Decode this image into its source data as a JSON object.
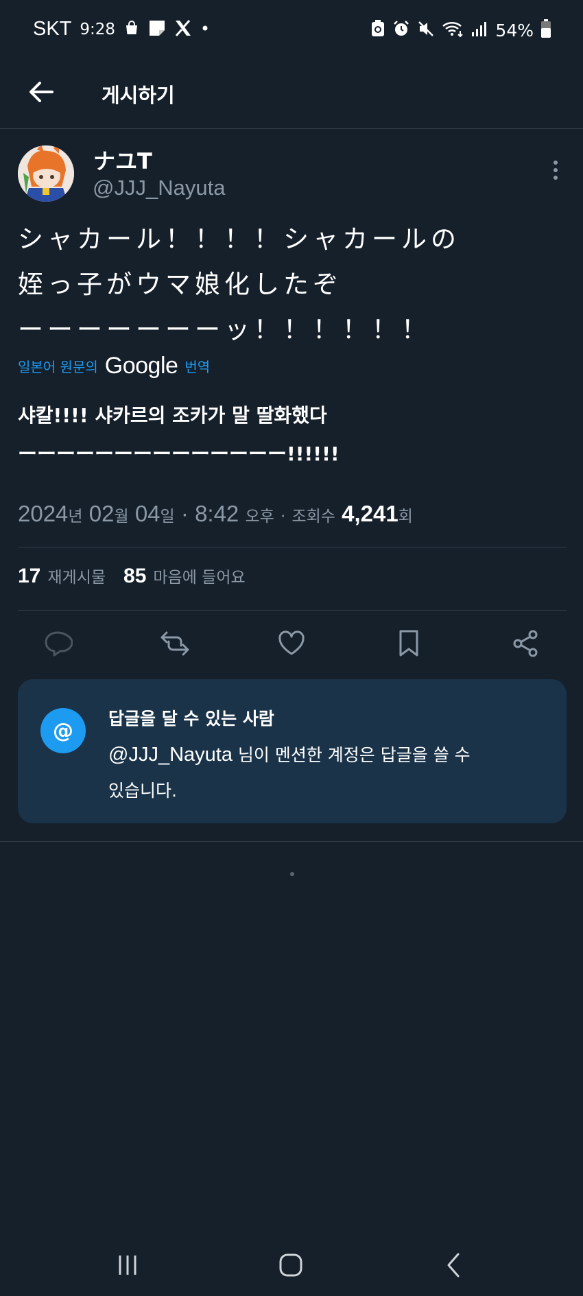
{
  "status_bar": {
    "carrier": "SKT",
    "time": "9:28",
    "battery": "54%",
    "icons": [
      "shopping-bag-icon",
      "note-icon",
      "x-logo-icon",
      "dot-icon",
      "battery-saver-icon",
      "alarm-icon",
      "mute-icon",
      "wifi-icon",
      "signal-icon",
      "battery-icon"
    ]
  },
  "header": {
    "title": "게시하기",
    "back_icon": "arrow-left-icon"
  },
  "tweet": {
    "display_name": "ナユT",
    "handle": "@JJJ_Nayuta",
    "text_lines": [
      "シャカール！！！！シャカールの",
      "姪っ子がウマ娘化したぞ",
      "ーーーーーーーッ！！！！！！"
    ],
    "translate": {
      "prefix": "일본어 원문의",
      "provider": "Google",
      "suffix": "번역"
    },
    "translated_lines": [
      "샤칼!!!! 샤카르의 조카가 말 딸화했다",
      "ーーーーーーーーーーーーーー!!!!!!"
    ],
    "meta": {
      "date": "2024",
      "year_unit": "년",
      "month": "02",
      "month_unit": "월",
      "day": "04",
      "day_unit": "일",
      "sep1": "·",
      "time": "8:42",
      "ampm": "오후",
      "sep2": "·",
      "views_label": "조회수",
      "views": "4,241",
      "views_unit": "회"
    },
    "stats": {
      "retweets": "17",
      "retweets_label": "재게시물",
      "likes": "85",
      "likes_label": "마음에 들어요"
    }
  },
  "actions": [
    "reply-icon",
    "retweet-icon",
    "heart-icon",
    "bookmark-icon",
    "share-icon"
  ],
  "reply_card": {
    "icon": "@",
    "title": "답글을 달 수 있는 사람",
    "mention": "@JJJ_Nayuta",
    "desc_rest": " 님이 멘션한 계정은 답글을 쓸 수",
    "desc_line2": "있습니다."
  },
  "colors": {
    "background": "#15202b",
    "accent": "#1d9bf0",
    "muted": "#8b98a5",
    "card": "#1a3349"
  }
}
